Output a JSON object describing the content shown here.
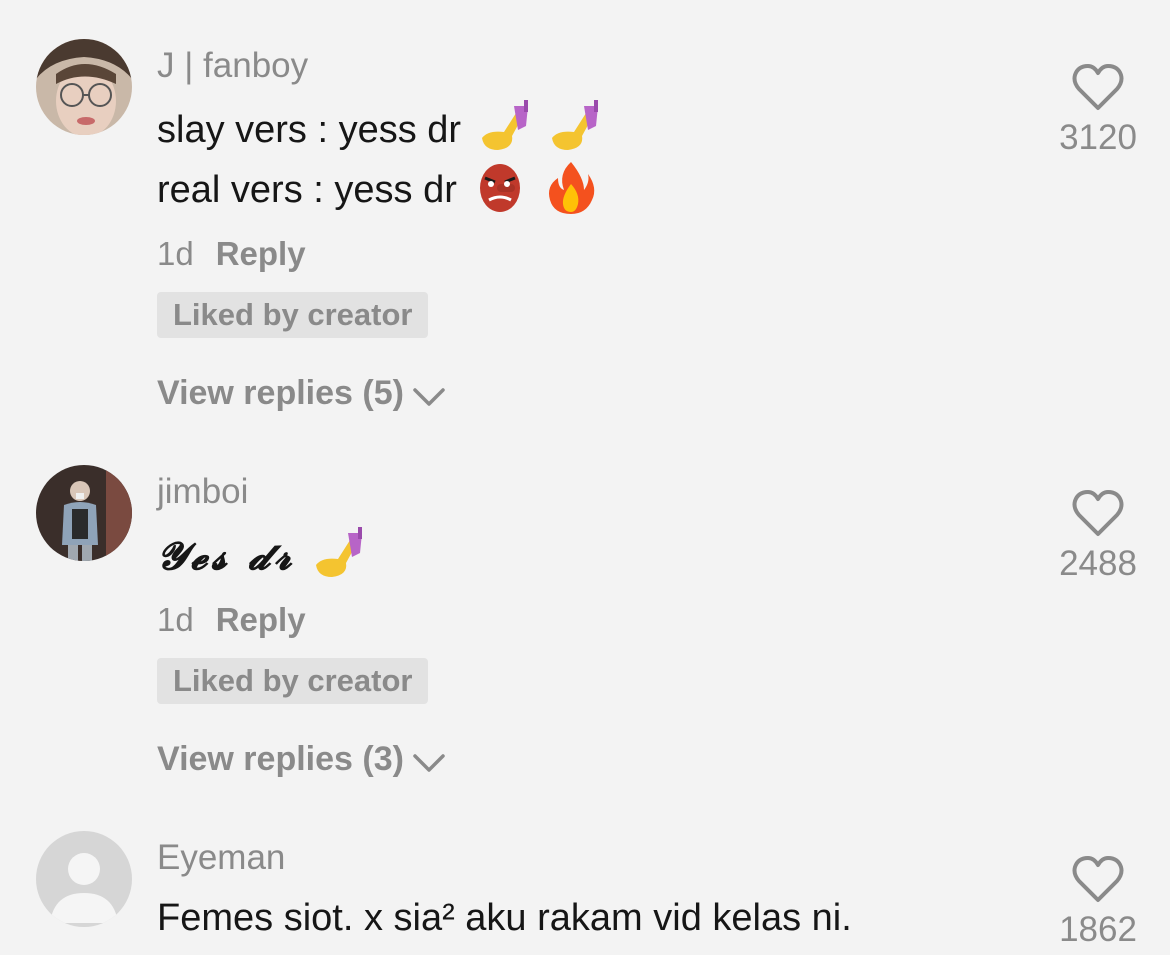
{
  "comments": [
    {
      "username": "J | fanboy",
      "lines": [
        "slay vers : yess dr",
        "real vers : yess dr"
      ],
      "time": "1d",
      "reply_label": "Reply",
      "liked_badge": "Liked by creator",
      "view_replies": "View replies (5)",
      "likes": "3120"
    },
    {
      "username": "jimboi",
      "lines": [
        "𝓨𝓮𝓼 𝓭𝓻"
      ],
      "time": "1d",
      "reply_label": "Reply",
      "liked_badge": "Liked by creator",
      "view_replies": "View replies (3)",
      "likes": "2488"
    },
    {
      "username": "Eyeman",
      "lines": [
        "Femes siot. x sia² aku rakam vid kelas ni."
      ],
      "likes": "1862"
    }
  ],
  "icons": {
    "heart": "heart-outline-icon",
    "chevron": "chevron-down-icon",
    "nail_polish": "nail-polish-emoji",
    "goblin": "japanese-goblin-emoji",
    "fire": "fire-emoji"
  },
  "colors": {
    "background": "#f3f3f3",
    "text": "#161616",
    "muted": "#8a8a8a",
    "badge_bg": "#e2e2e2"
  }
}
